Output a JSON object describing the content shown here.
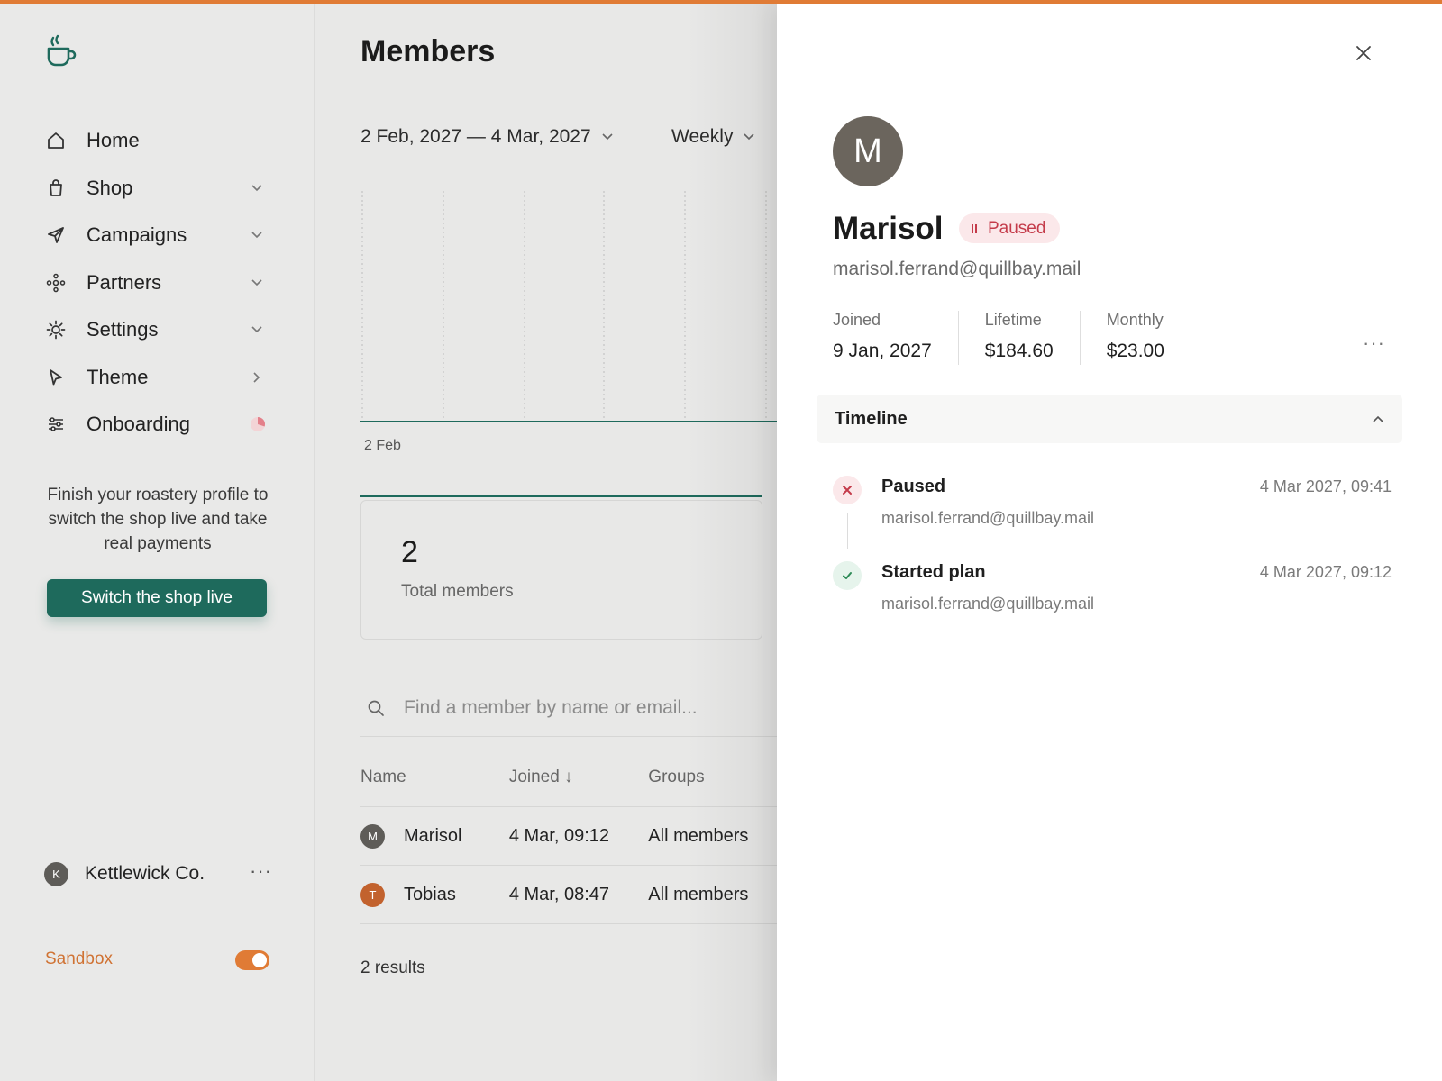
{
  "colors": {
    "accent": "#e07b35",
    "primary": "#1e6a5c",
    "paused": "#c43b4a",
    "success": "#2e8b57"
  },
  "sidebar": {
    "logo_icon": "coffee-cup-icon",
    "items": [
      {
        "label": "Home",
        "icon": "home-icon",
        "chevron": "none"
      },
      {
        "label": "Shop",
        "icon": "shopping-bag-icon",
        "chevron": "down"
      },
      {
        "label": "Campaigns",
        "icon": "paper-plane-icon",
        "chevron": "down"
      },
      {
        "label": "Partners",
        "icon": "network-icon",
        "chevron": "down"
      },
      {
        "label": "Settings",
        "icon": "gear-icon",
        "chevron": "down"
      },
      {
        "label": "Theme",
        "icon": "cursor-icon",
        "chevron": "right"
      },
      {
        "label": "Onboarding",
        "icon": "sliders-icon",
        "chevron": "progress-icon"
      }
    ],
    "promo_text": "Finish your roastery profile to switch the shop live and take real payments",
    "live_button": "Switch the shop live",
    "account": {
      "initial": "K",
      "name": "Kettlewick Co.",
      "more": "···"
    },
    "sandbox_label": "Sandbox",
    "sandbox_on": true
  },
  "main": {
    "title": "Members",
    "date_range": "2 Feb, 2027 — 4 Mar, 2027",
    "frequency": "Weekly",
    "x_tick": "2 Feb",
    "stat": {
      "value": "2",
      "label": "Total members"
    },
    "search_placeholder": "Find a member by name or email...",
    "table": {
      "headers": {
        "name": "Name",
        "joined": "Joined ↓",
        "groups": "Groups"
      },
      "rows": [
        {
          "initial": "M",
          "name": "Marisol",
          "joined": "4 Mar, 09:12",
          "groups": "All members",
          "avatar_color": "#5e5c58"
        },
        {
          "initial": "T",
          "name": "Tobias",
          "joined": "4 Mar, 08:47",
          "groups": "All members",
          "avatar_color": "#c2622e"
        }
      ]
    },
    "results": "2 results"
  },
  "drawer": {
    "avatar_initial": "M",
    "name": "Marisol",
    "status": "Paused",
    "email": "marisol.ferrand@quillbay.mail",
    "stats": [
      {
        "title": "Joined",
        "value": "9 Jan, 2027"
      },
      {
        "title": "Lifetime",
        "value": "$184.60"
      },
      {
        "title": "Monthly",
        "value": "$23.00"
      }
    ],
    "more": "···",
    "timeline_title": "Timeline",
    "events": [
      {
        "title": "Paused",
        "sub": "marisol.ferrand@quillbay.mail",
        "time": "4 Mar 2027, 09:41",
        "kind": "x-icon"
      },
      {
        "title": "Started plan",
        "sub": "marisol.ferrand@quillbay.mail",
        "time": "4 Mar 2027, 09:12",
        "kind": "check-icon"
      }
    ]
  }
}
